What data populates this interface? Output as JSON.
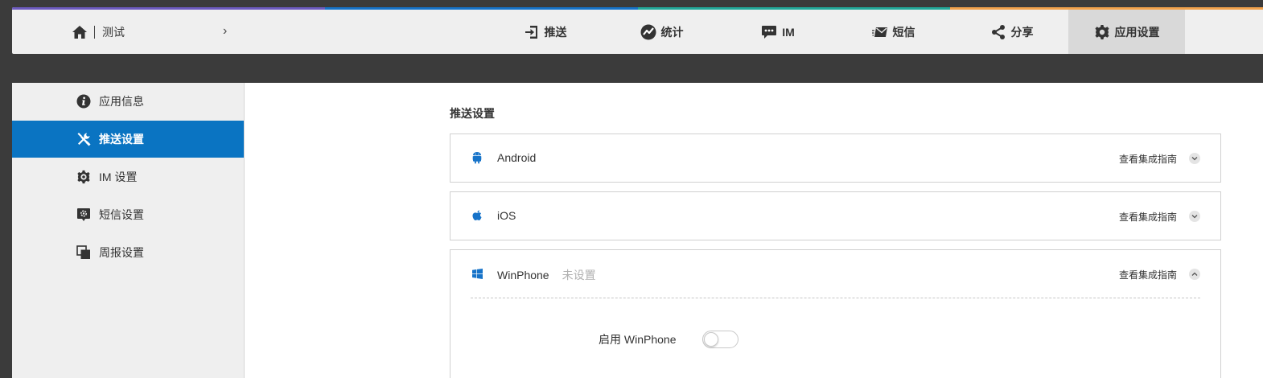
{
  "colors": {
    "strip": [
      "#6d5bbf",
      "#1673c9",
      "#23a99a",
      "#f1a24c"
    ],
    "active_sidebar": "#0a74c2",
    "icon_blue": "#1673c9"
  },
  "header": {
    "home_icon": "home-icon",
    "app_name": "测试",
    "arrow": "›"
  },
  "nav": [
    {
      "label": "推送",
      "icon": "push-icon"
    },
    {
      "label": "统计",
      "icon": "stats-icon"
    },
    {
      "label": "IM",
      "icon": "im-icon"
    },
    {
      "label": "短信",
      "icon": "sms-icon"
    },
    {
      "label": "分享",
      "icon": "share-icon"
    },
    {
      "label": "应用设置",
      "icon": "gear-icon",
      "active": true
    }
  ],
  "sidebar": {
    "items": [
      {
        "label": "应用信息",
        "icon": "info-icon"
      },
      {
        "label": "推送设置",
        "icon": "tools-icon",
        "active": true
      },
      {
        "label": "IM 设置",
        "icon": "gear-icon"
      },
      {
        "label": "短信设置",
        "icon": "sms-settings-icon"
      },
      {
        "label": "周报设置",
        "icon": "copy-icon"
      }
    ]
  },
  "main": {
    "section_title": "推送设置",
    "platforms": [
      {
        "name": "Android",
        "status": "",
        "guide": "查看集成指南",
        "icon": "android-icon",
        "expanded": false
      },
      {
        "name": "iOS",
        "status": "",
        "guide": "查看集成指南",
        "icon": "apple-icon",
        "expanded": false
      },
      {
        "name": "WinPhone",
        "status": "未设置",
        "guide": "查看集成指南",
        "icon": "windows-icon",
        "expanded": true
      }
    ],
    "winphone_enable_label": "启用 WinPhone",
    "winphone_enabled": false
  }
}
